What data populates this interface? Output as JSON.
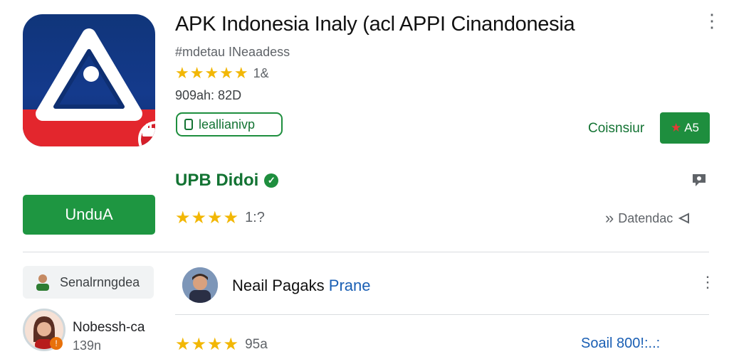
{
  "app": {
    "title": "APK Indonesia Inaly (acl APPI Cinandonesia",
    "subtitle": "#mdetau INeaadess",
    "rating_stars": "★★★★★",
    "rating_value": "1&",
    "size_text": "909ah: 82D",
    "install_chip_label": "leallianivp",
    "consult_label": "Coisnsiur",
    "green_small_label": "A5",
    "download_label": "UnduA"
  },
  "developer": {
    "name": "UPB Didoi",
    "verified_mark": "✓",
    "rating_stars": "★★★★",
    "rating_value": "1:?",
    "action_label": "Datendac"
  },
  "similar": {
    "chip_label": "Senalrnngdea"
  },
  "review": {
    "reviewer_name": "Neail Pagaks",
    "reviewer_tag": "Prane",
    "second_name": "Nobessh-ca",
    "second_sub": "139n",
    "rating_stars": "★★★★",
    "rating_value": "95a",
    "link_label": "Soail 800!:..:"
  },
  "colors": {
    "brand_green": "#1e8e3e",
    "star_yellow": "#f2b705",
    "icon_blue": "#10357a",
    "icon_red": "#e3262d"
  },
  "icons": [
    "app-logo-icon",
    "more-vert-icon",
    "star-icon",
    "pointer-icon",
    "phone-icon",
    "verified-icon",
    "chat-icon",
    "chevron-right-icon",
    "share-icon",
    "avatar-icon"
  ]
}
